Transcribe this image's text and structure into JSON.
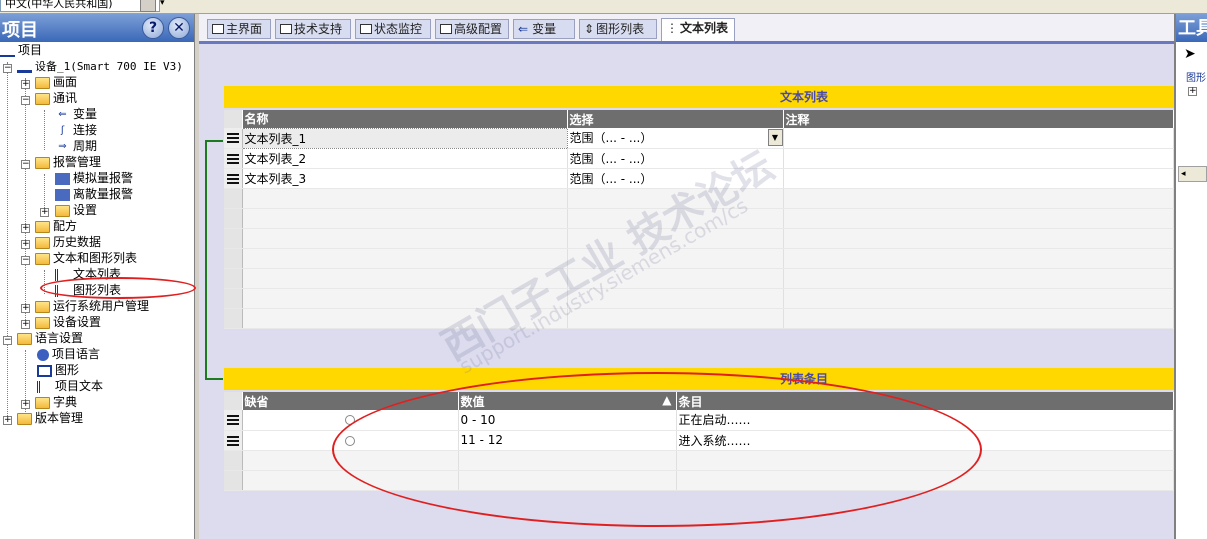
{
  "topbar": {
    "combo_value": "中文(中华人民共和国)"
  },
  "project_panel": {
    "title": "项目",
    "help_icon": "?",
    "close_icon": "✕",
    "tree": [
      {
        "label": "项目",
        "icon": "project-icon"
      },
      {
        "label": "设备_1(Smart 700 IE V3)",
        "icon": "device-icon"
      },
      {
        "label": "画面",
        "icon": "folder-icon"
      },
      {
        "label": "通讯",
        "icon": "folder-icon"
      },
      {
        "label": "变量",
        "icon": "variable-icon"
      },
      {
        "label": "连接",
        "icon": "connection-icon"
      },
      {
        "label": "周期",
        "icon": "cycle-icon"
      },
      {
        "label": "报警管理",
        "icon": "folder-icon"
      },
      {
        "label": "模拟量报警",
        "icon": "analog-alarm-icon"
      },
      {
        "label": "离散量报警",
        "icon": "discrete-alarm-icon"
      },
      {
        "label": "设置",
        "icon": "settings-icon"
      },
      {
        "label": "配方",
        "icon": "recipe-icon"
      },
      {
        "label": "历史数据",
        "icon": "history-icon"
      },
      {
        "label": "文本和图形列表",
        "icon": "folder-icon"
      },
      {
        "label": "文本列表",
        "icon": "text-list-icon"
      },
      {
        "label": "图形列表",
        "icon": "graphic-list-icon"
      },
      {
        "label": "运行系统用户管理",
        "icon": "user-admin-icon"
      },
      {
        "label": "设备设置",
        "icon": "device-settings-icon"
      },
      {
        "label": "语言设置",
        "icon": "folder-icon"
      },
      {
        "label": "项目语言",
        "icon": "globe-icon"
      },
      {
        "label": "图形",
        "icon": "graphics-icon"
      },
      {
        "label": "项目文本",
        "icon": "project-text-icon"
      },
      {
        "label": "字典",
        "icon": "dictionary-icon"
      },
      {
        "label": "版本管理",
        "icon": "folder-icon"
      }
    ]
  },
  "tabs": [
    {
      "label": "主界面"
    },
    {
      "label": "技术支持"
    },
    {
      "label": "状态监控"
    },
    {
      "label": "高级配置"
    },
    {
      "label": "变量"
    },
    {
      "label": "图形列表"
    },
    {
      "label": "文本列表"
    }
  ],
  "text_list": {
    "section_title": "文本列表",
    "columns": [
      "名称",
      "选择",
      "注释"
    ],
    "rows": [
      {
        "name": "文本列表_1",
        "selection": "范围（... - ...）",
        "comment": ""
      },
      {
        "name": "文本列表_2",
        "selection": "范围（... - ...）",
        "comment": ""
      },
      {
        "name": "文本列表_3",
        "selection": "范围（... - ...）",
        "comment": ""
      }
    ]
  },
  "list_entries": {
    "section_title": "列表条目",
    "columns": [
      "缺省",
      "数值",
      "条目"
    ],
    "rows": [
      {
        "default": "",
        "value": "0 - 10",
        "entry": "正在启动……"
      },
      {
        "default": "",
        "value": "11 - 12",
        "entry": "进入系统……"
      }
    ]
  },
  "watermark": {
    "line1": "西门子工业 技术论坛",
    "line2": "support.industry.siemens.com/cs"
  },
  "tools_panel": {
    "title": "工具",
    "sub": "图形"
  },
  "colors": {
    "section_bar": "#ffd800",
    "header_bg": "#6e6e6e",
    "annotation_red": "#e02020",
    "annotation_green": "#1e7a1e"
  }
}
